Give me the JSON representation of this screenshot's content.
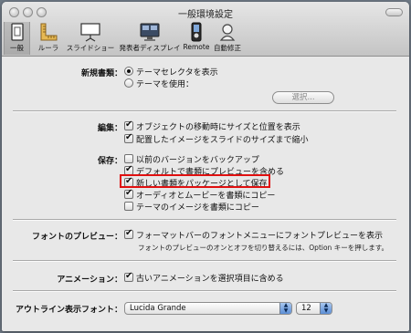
{
  "window": {
    "title": "一般環境設定"
  },
  "toolbar": {
    "items": [
      {
        "label": "一般",
        "icon": "general-icon",
        "selected": true
      },
      {
        "label": "ルーラ",
        "icon": "ruler-icon"
      },
      {
        "label": "スライドショー",
        "icon": "slideshow-icon"
      },
      {
        "label": "発表者ディスプレイ",
        "icon": "presenter-display-icon"
      },
      {
        "label": "Remote",
        "icon": "remote-icon"
      },
      {
        "label": "自動修正",
        "icon": "autocorrect-icon"
      }
    ]
  },
  "new_document": {
    "label": "新規書類：",
    "options": [
      "テーマセレクタを表示",
      "テーマを使用："
    ],
    "selected_index": 0,
    "choose_button": "選択..."
  },
  "editing": {
    "label": "編集：",
    "items": [
      {
        "text": "オブジェクトの移動時にサイズと位置を表示",
        "checked": true
      },
      {
        "text": "配置したイメージをスライドのサイズまで縮小",
        "checked": true
      }
    ]
  },
  "saving": {
    "label": "保存：",
    "items": [
      {
        "text": "以前のバージョンをバックアップ",
        "checked": false
      },
      {
        "text": "デフォルトで書類にプレビューを含める",
        "checked": true
      },
      {
        "text": "新しい書類をパッケージとして保存",
        "checked": true
      },
      {
        "text": "オーディオとムービーを書類にコピー",
        "checked": true
      },
      {
        "text": "テーマのイメージを書類にコピー",
        "checked": false
      }
    ]
  },
  "font_preview": {
    "label": "フォントのプレビュー：",
    "item": {
      "text": "フォーマットバーのフォントメニューにフォントプレビューを表示",
      "checked": true
    },
    "note": "フォントのプレビューのオンとオフを切り替えるには、Option キーを押します。"
  },
  "animation": {
    "label": "アニメーション：",
    "item": {
      "text": "古いアニメーションを選択項目に含める",
      "checked": true
    }
  },
  "outline_font": {
    "label": "アウトライン表示フォント：",
    "font": "Lucida Grande",
    "size": "12"
  },
  "colors": {
    "highlight": "#e01010"
  }
}
